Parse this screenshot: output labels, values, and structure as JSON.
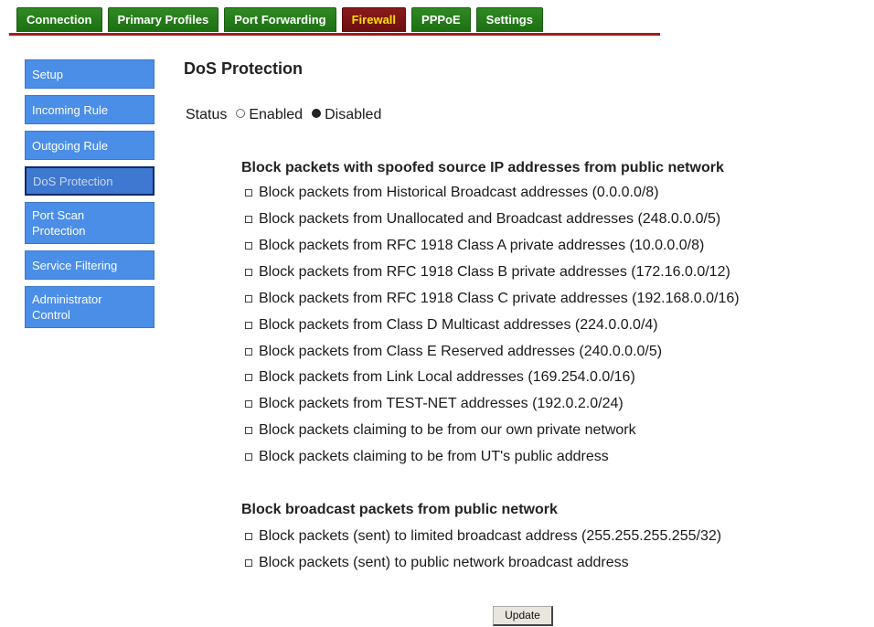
{
  "top_nav": {
    "tabs": [
      {
        "label": "Connection",
        "active": false
      },
      {
        "label": "Primary Profiles",
        "active": false
      },
      {
        "label": "Port Forwarding",
        "active": false
      },
      {
        "label": "Firewall",
        "active": true
      },
      {
        "label": "PPPoE",
        "active": false
      },
      {
        "label": "Settings",
        "active": false
      }
    ]
  },
  "sidebar": {
    "items": [
      {
        "label": "Setup",
        "active": false
      },
      {
        "label": "Incoming Rule",
        "active": false
      },
      {
        "label": "Outgoing Rule",
        "active": false
      },
      {
        "label": "DoS Protection",
        "active": true
      },
      {
        "label_line1": "Port Scan",
        "label_line2": "Protection",
        "active": false
      },
      {
        "label": "Service Filtering",
        "active": false
      },
      {
        "label_line1": "Administrator",
        "label_line2": "Control",
        "active": false
      }
    ]
  },
  "main": {
    "title": "DoS Protection",
    "status": {
      "label": "Status",
      "options": [
        {
          "label": "Enabled",
          "checked": false
        },
        {
          "label": "Disabled",
          "checked": true
        }
      ]
    },
    "spoofed_section": {
      "title": "Block packets with spoofed source IP addresses from public network",
      "items": [
        {
          "label": "Block packets from Historical Broadcast addresses (0.0.0.0/8)",
          "checked": false
        },
        {
          "label": "Block packets from Unallocated and Broadcast addresses (248.0.0.0/5)",
          "checked": false
        },
        {
          "label": "Block packets from RFC 1918 Class A private addresses (10.0.0.0/8)",
          "checked": false
        },
        {
          "label": "Block packets from RFC 1918 Class B private addresses (172.16.0.0/12)",
          "checked": false
        },
        {
          "label": "Block packets from RFC 1918 Class C private addresses (192.168.0.0/16)",
          "checked": false
        },
        {
          "label": "Block packets from Class D Multicast addresses (224.0.0.0/4)",
          "checked": false
        },
        {
          "label": "Block packets from Class E Reserved addresses (240.0.0.0/5)",
          "checked": false
        },
        {
          "label": "Block packets from Link Local addresses (169.254.0.0/16)",
          "checked": false
        },
        {
          "label": "Block packets from TEST-NET addresses (192.0.2.0/24)",
          "checked": false
        },
        {
          "label": "Block packets claiming to be from our own private network",
          "checked": false
        },
        {
          "label": "Block packets claiming to be from UT's public address",
          "checked": false
        }
      ]
    },
    "broadcast_section": {
      "title": "Block broadcast packets from public network",
      "items": [
        {
          "label": "Block packets (sent) to limited broadcast address (255.255.255.255/32)",
          "checked": false
        },
        {
          "label": "Block packets (sent) to public network broadcast address",
          "checked": false
        }
      ]
    },
    "update_label": "Update"
  },
  "colors": {
    "tab_green": "#2f8a22",
    "tab_active_bg": "#8a1a1a",
    "tab_active_text": "#ffe000",
    "nav_line_red": "#a41c1c",
    "sidebar_blue": "#4b8ee8",
    "sidebar_active_border": "#0d2a6b"
  }
}
